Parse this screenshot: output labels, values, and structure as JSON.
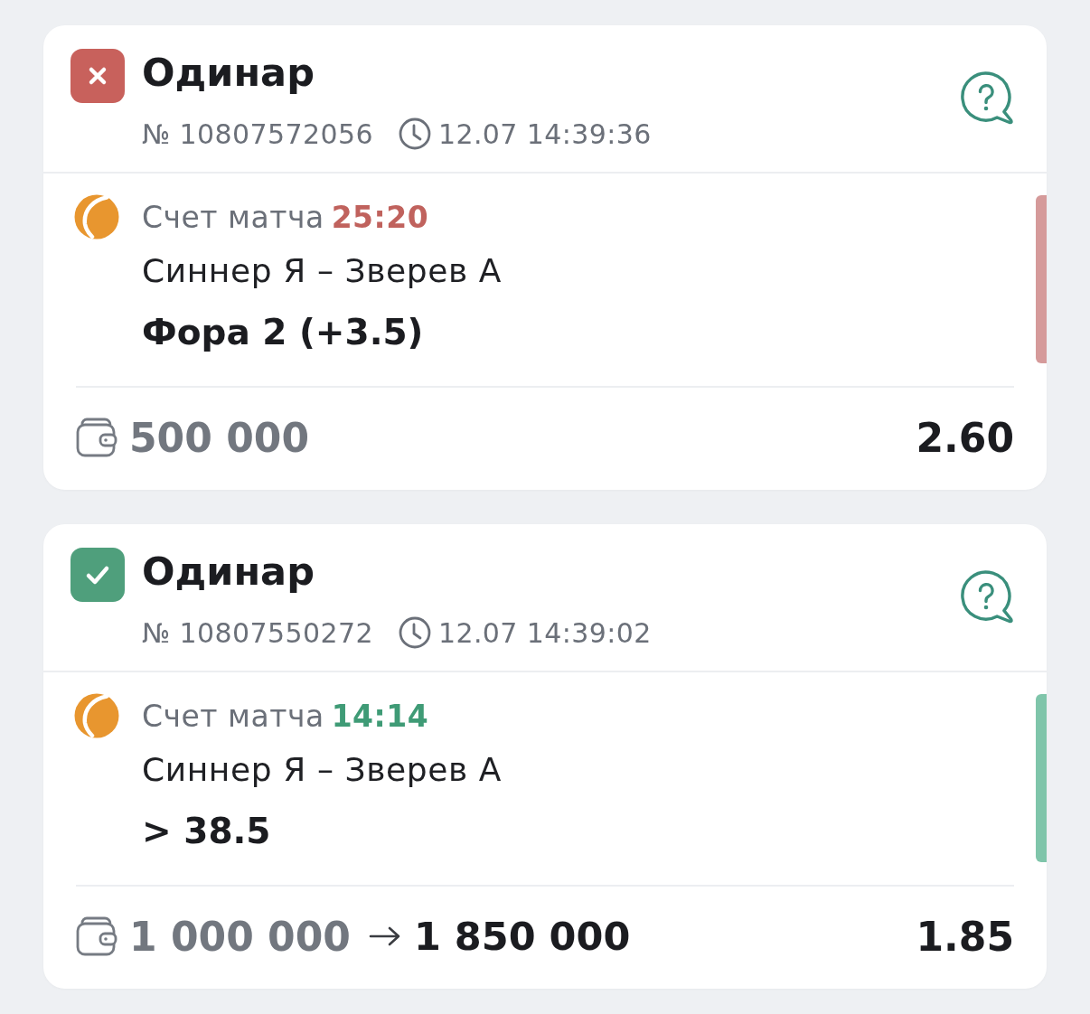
{
  "bets": [
    {
      "kind": "lost",
      "title": "Одинар",
      "number": "№ 10807572056",
      "time": "12.07 14:39:36",
      "event": {
        "label": "Счет матча",
        "score": "25:20",
        "teams": "Синнер Я – Зверев А",
        "market": "Фора 2 (+3.5)"
      },
      "stake": "500 000",
      "odds": "2.60"
    },
    {
      "kind": "won",
      "title": "Одинар",
      "number": "№ 10807550272",
      "time": "12.07 14:39:02",
      "event": {
        "label": "Счет матча",
        "score": "14:14",
        "teams": "Синнер Я – Зверев А",
        "market": "> 38.5"
      },
      "stake": "1 000 000",
      "payout": "1 850 000",
      "odds": "1.85"
    }
  ]
}
